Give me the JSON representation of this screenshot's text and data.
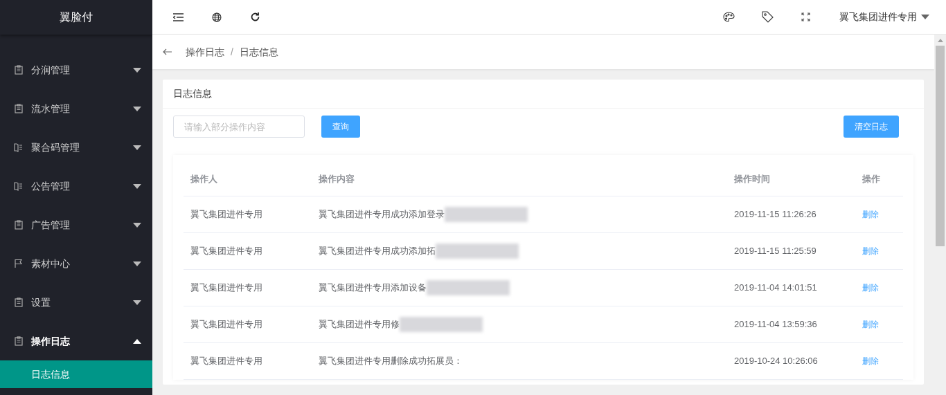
{
  "sidebar": {
    "logo": "翼脸付",
    "items": [
      {
        "label": "分润管理",
        "kind": "clipboard",
        "expanded": false
      },
      {
        "label": "流水管理",
        "kind": "clipboard",
        "expanded": false
      },
      {
        "label": "聚合码管理",
        "kind": "book",
        "expanded": false
      },
      {
        "label": "公告管理",
        "kind": "book",
        "expanded": false
      },
      {
        "label": "广告管理",
        "kind": "clipboard",
        "expanded": false
      },
      {
        "label": "素材中心",
        "kind": "flag",
        "expanded": false
      },
      {
        "label": "设置",
        "kind": "clipboard",
        "expanded": false
      },
      {
        "label": "操作日志",
        "kind": "clipboard",
        "expanded": true,
        "children": [
          {
            "label": "日志信息",
            "selected": true
          }
        ]
      }
    ]
  },
  "topbar": {
    "user": "翼飞集团进件专用"
  },
  "breadcrumb": {
    "items": [
      "操作日志",
      "日志信息"
    ],
    "separator": "/"
  },
  "card": {
    "title": "日志信息",
    "search": {
      "placeholder": "请输入部分操作内容"
    },
    "query_button": "查询",
    "clear_button": "清空日志",
    "table": {
      "columns": [
        "操作人",
        "操作内容",
        "操作时间",
        "操作"
      ],
      "rows": [
        {
          "operator": "翼飞集团进件专用",
          "content": "翼飞集团进件专用成功添加登录",
          "blurred": true,
          "time": "2019-11-15 11:26:26",
          "action": "删除"
        },
        {
          "operator": "翼飞集团进件专用",
          "content": "翼飞集团进件专用成功添加拓",
          "blurred": true,
          "time": "2019-11-15 11:25:59",
          "action": "删除"
        },
        {
          "operator": "翼飞集团进件专用",
          "content": "翼飞集团进件专用添加设备",
          "blurred": true,
          "time": "2019-11-04 14:01:51",
          "action": "删除"
        },
        {
          "operator": "翼飞集团进件专用",
          "content": "翼飞集团进件专用修",
          "blurred": true,
          "time": "2019-11-04 13:59:36",
          "action": "删除"
        },
        {
          "operator": "翼飞集团进件专用",
          "content": "翼飞集团进件专用删除成功拓展员：",
          "blurred": false,
          "time": "2019-10-24 10:26:06",
          "action": "删除"
        }
      ]
    }
  }
}
